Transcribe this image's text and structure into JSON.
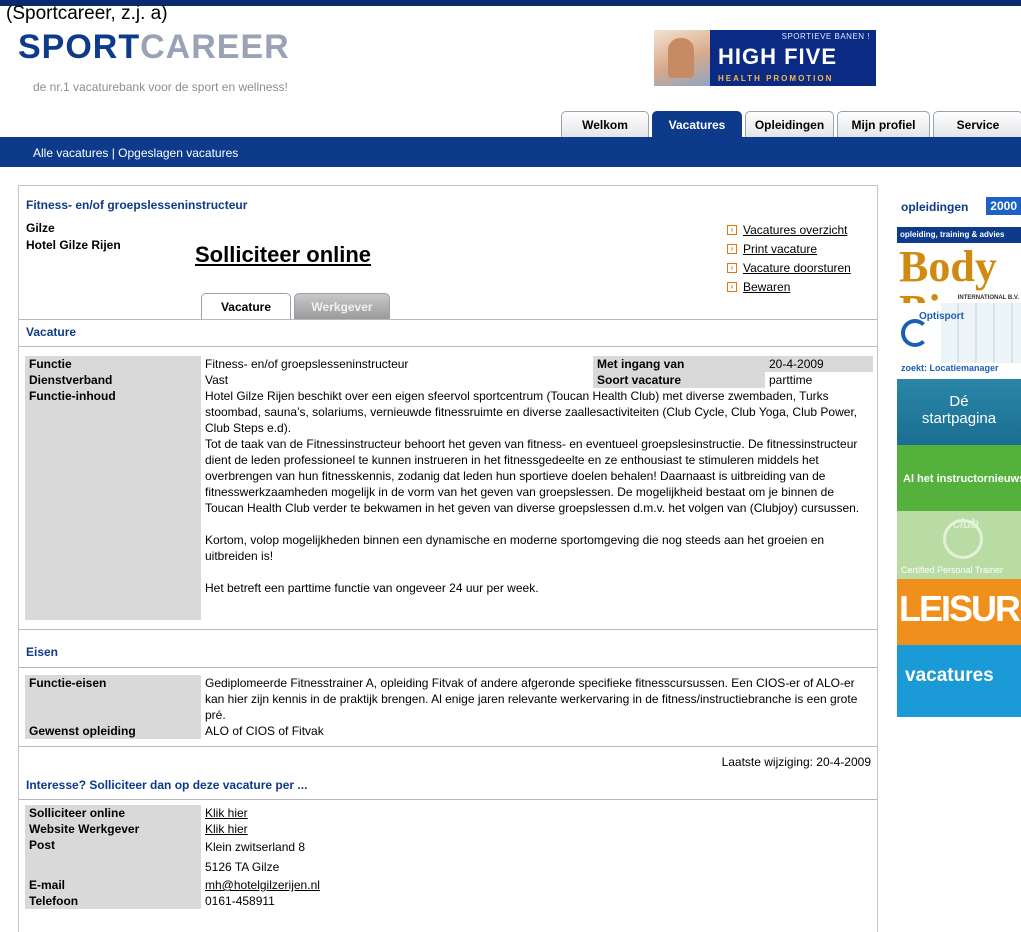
{
  "citation": "(Sportcareer, z.j. a)",
  "logo": {
    "part1": "SPORT",
    "part2": "CAREER",
    "tagline": "de nr.1 vacaturebank voor de sport en wellness!"
  },
  "banner": {
    "top": "SPORTIEVE BANEN !",
    "main": "HIGH FIVE",
    "sub": "HEALTH PROMOTION"
  },
  "tabs": [
    {
      "label": "Welkom"
    },
    {
      "label": "Vacatures"
    },
    {
      "label": "Opleidingen"
    },
    {
      "label": "Mijn profiel"
    },
    {
      "label": "Service"
    }
  ],
  "navbar": {
    "link1": "Alle vacatures",
    "separator": " | ",
    "link2": "Opgeslagen vacatures"
  },
  "header": {
    "title": "Fitness- en/of groepslesseninstructeur",
    "place": "Gilze",
    "company": "Hotel Gilze Rijen",
    "apply": "Solliciteer online"
  },
  "side_links": [
    {
      "label": "Vacatures overzicht"
    },
    {
      "label": "Print vacature"
    },
    {
      "label": "Vacature doorsturen"
    },
    {
      "label": "Bewaren"
    }
  ],
  "subtabs": {
    "active": "Vacature",
    "inactive": "Werkgever"
  },
  "vacature": {
    "section": "Vacature",
    "functie_label": "Functie",
    "functie_value": "Fitness- en/of groepslesseninstructeur",
    "met_ingang_label": "Met ingang van",
    "met_ingang_value": "20-4-2009",
    "dienstverband_label": "Dienstverband",
    "dienstverband_value": "Vast",
    "soort_label": "Soort vacature",
    "soort_value": "parttime",
    "inhoud_label": "Functie-inhoud",
    "inhoud_p1": "Hotel Gilze Rijen beschikt over een eigen sfeervol sportcentrum (Toucan Health Club) met diverse zwembaden, Turks stoombad, sauna’s, solariums, vernieuwde fitnessruimte en diverse zaallesactiviteiten (Club Cycle, Club Yoga, Club Power, Club Steps e.d).",
    "inhoud_p2": "Tot de taak van de Fitnessinstructeur behoort het geven van fitness- en eventueel groepslesinstructie. De fitnessinstructeur dient de leden professioneel te kunnen instrueren in het fitnessgedeelte en ze enthousiast te stimuleren middels het overbrengen van hun fitnesskennis, zodanig dat leden hun sportieve doelen behalen! Daarnaast is uitbreiding van de fitnesswerkzaamheden mogelijk in de vorm van het geven van groepslessen. De mogelijkheid bestaat om je binnen de Toucan Health Club verder te bekwamen in het geven van diverse groepslessen d.m.v. het volgen van (Clubjoy) cursussen.",
    "inhoud_p3": "Kortom, volop mogelijkheden binnen een dynamische en moderne sportomgeving die nog steeds aan het groeien en uitbreiden is!",
    "inhoud_p4": "Het betreft een parttime functie van ongeveer 24 uur per week."
  },
  "eisen": {
    "section": "Eisen",
    "functie_eisen_label": "Functie-eisen",
    "functie_eisen_value": "Gediplomeerde Fitnesstrainer A, opleiding Fitvak of andere afgeronde specifieke fitnesscursussen. Een CIOS-er of ALO-er kan hier zijn kennis in de praktijk brengen. Al enige jaren relevante werkervaring in de fitness/instructiebranche is een grote pré.",
    "opleiding_label": "Gewenst opleiding",
    "opleiding_value": "ALO of CIOS of Fitvak"
  },
  "laatste": "Laatste wijziging: 20-4-2009",
  "contact": {
    "section": "Interesse?  Solliciteer dan op deze vacature per ...",
    "online_label": "Solliciteer online",
    "online_value": "Klik hier",
    "website_label": "Website Werkgever",
    "website_value": "Klik hier",
    "post_label": "Post",
    "post_line1": "Klein zwitserland 8",
    "post_line2": "5126 TA Gilze",
    "email_label": "E-mail",
    "email_value": "mh@hotelgilzerijen.nl",
    "telefoon_label": "Telefoon",
    "telefoon_value": "0161-458911"
  },
  "ads": {
    "ad1_text": "opleidingen",
    "ad1_num": "2000",
    "ad2_text": "opleiding, training & advies",
    "ad3_text": "Body Biz",
    "ad3_small": "INTERNATIONAL B.V.",
    "ad4_brand": "Optisport",
    "ad4_text": "zoekt: Locatiemanager",
    "ad5_line1": "Dé",
    "ad5_line2": "startpagina",
    "ad6_text": "Al het instructornieuws?",
    "ad7_club": "club",
    "ad7_text": "Certified Personal Trainer",
    "ad8_text": "LEISURE",
    "ad9_text": "vacatures"
  }
}
